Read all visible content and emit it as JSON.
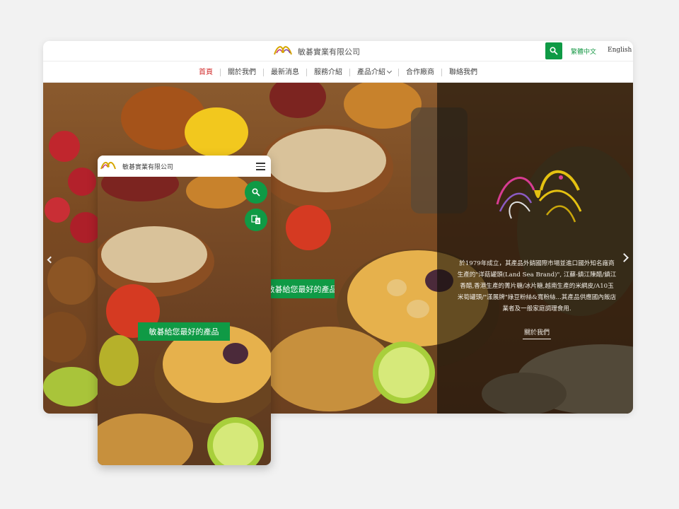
{
  "colors": {
    "accent": "#0f9a45",
    "active_nav": "#d12b2b"
  },
  "header": {
    "company_name": "敏碁實業有限公司",
    "search_icon": "search-icon",
    "lang_zh": "繁體中文",
    "lang_en": "English"
  },
  "nav": {
    "items": [
      {
        "label": "首頁"
      },
      {
        "label": "關於我們"
      },
      {
        "label": "最新消息"
      },
      {
        "label": "服務介紹"
      },
      {
        "label": "產品介紹"
      },
      {
        "label": "合作廠商"
      },
      {
        "label": "聯絡我們"
      }
    ]
  },
  "hero": {
    "banner": "敏碁給您最好的產品",
    "about_text": "於1979年成立，其產品外銷國際市場並進口國外知名廠商生產的\"洋菇罐頭(Land Sea Brand)\", 江蘇-鎮江陳醋/鎮江香醋,香港生產的菁片糖/冰片糖,越南生產的米網皮/A10玉米筍罐頭/\"漾展牌\"綠豆粉絲&寬粉絲...其產品供應國內飯店業者及一般家庭調理食用.",
    "about_button": "關於我們"
  },
  "mobile": {
    "company_name": "敏碁實業有限公司",
    "banner": "敏碁給您最好的產品"
  }
}
